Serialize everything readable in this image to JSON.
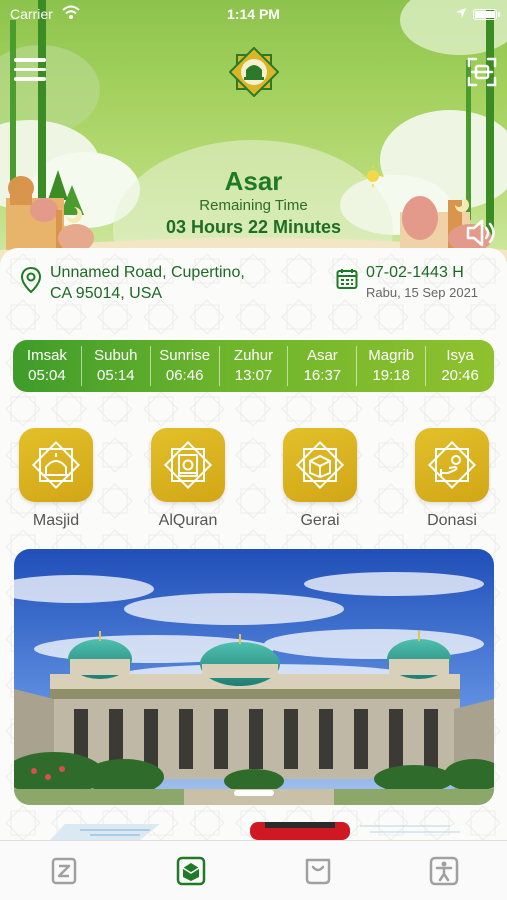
{
  "status_bar": {
    "carrier": "Carrier",
    "time": "1:14 PM"
  },
  "header": {
    "current_prayer": "Asar",
    "remaining_label": "Remaining Time",
    "remaining_value": "03 Hours 22 Minutes"
  },
  "location": {
    "address_line1": "Unnamed Road, Cupertino,",
    "address_line2": "CA 95014, USA"
  },
  "date": {
    "hijri": "07-02-1443 H",
    "gregorian": "Rabu, 15 Sep 2021"
  },
  "prayer_times": [
    {
      "name": "Imsak",
      "time": "05:04"
    },
    {
      "name": "Subuh",
      "time": "05:14"
    },
    {
      "name": "Sunrise",
      "time": "06:46"
    },
    {
      "name": "Zuhur",
      "time": "13:07"
    },
    {
      "name": "Asar",
      "time": "16:37"
    },
    {
      "name": "Magrib",
      "time": "19:18"
    },
    {
      "name": "Isya",
      "time": "20:46"
    }
  ],
  "menu": [
    {
      "label": "Masjid",
      "icon": "mosque-icon"
    },
    {
      "label": "AlQuran",
      "icon": "quran-icon"
    },
    {
      "label": "Gerai",
      "icon": "kaaba-icon"
    },
    {
      "label": "Donasi",
      "icon": "donation-icon"
    }
  ],
  "tabs": [
    {
      "icon": "zakat-icon"
    },
    {
      "icon": "home-icon"
    },
    {
      "icon": "bag-icon"
    },
    {
      "icon": "profile-icon"
    }
  ],
  "colors": {
    "primary_green": "#1f7a26",
    "gold": "#d4a817",
    "bar_gradient_start": "#3e9c2a",
    "bar_gradient_end": "#8fc12e"
  },
  "banner_page_index": 1
}
